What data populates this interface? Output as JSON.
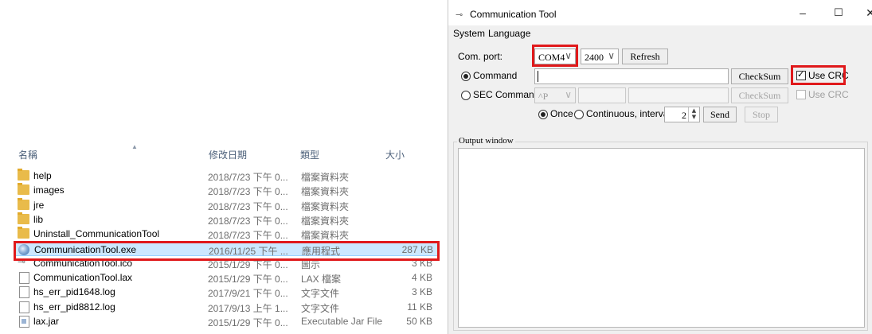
{
  "explorer": {
    "columns": {
      "name": "名稱",
      "date": "修改日期",
      "type": "類型",
      "size": "大小"
    },
    "files": [
      {
        "name": "help",
        "date": "2018/7/23 下午 0...",
        "type": "檔案資料夾",
        "size": "",
        "icon": "folder-icon"
      },
      {
        "name": "images",
        "date": "2018/7/23 下午 0...",
        "type": "檔案資料夾",
        "size": "",
        "icon": "folder-icon"
      },
      {
        "name": "jre",
        "date": "2018/7/23 下午 0...",
        "type": "檔案資料夾",
        "size": "",
        "icon": "folder-icon"
      },
      {
        "name": "lib",
        "date": "2018/7/23 下午 0...",
        "type": "檔案資料夾",
        "size": "",
        "icon": "folder-icon"
      },
      {
        "name": "Uninstall_CommunicationTool",
        "date": "2018/7/23 下午 0...",
        "type": "檔案資料夾",
        "size": "",
        "icon": "folder-icon"
      },
      {
        "name": "CommunicationTool.exe",
        "date": "2016/11/25 下午 ...",
        "type": "應用程式",
        "size": "287 KB",
        "icon": "exe-icon",
        "selected": true
      },
      {
        "name": "CommunicationTool.ico",
        "date": "2015/1/29 下午 0...",
        "type": "圖示",
        "size": "3 KB",
        "icon": "ico-icon"
      },
      {
        "name": "CommunicationTool.lax",
        "date": "2015/1/29 下午 0...",
        "type": "LAX 檔案",
        "size": "4 KB",
        "icon": "file-icon"
      },
      {
        "name": "hs_err_pid1648.log",
        "date": "2017/9/21 下午 0...",
        "type": "文字文件",
        "size": "3 KB",
        "icon": "text-file-icon"
      },
      {
        "name": "hs_err_pid8812.log",
        "date": "2017/9/13 上午 1...",
        "type": "文字文件",
        "size": "11 KB",
        "icon": "text-file-icon"
      },
      {
        "name": "lax.jar",
        "date": "2015/1/29 下午 0...",
        "type": "Executable Jar File",
        "size": "50 KB",
        "icon": "jar-icon"
      }
    ]
  },
  "comm": {
    "title": "Communication Tool",
    "window_controls": {
      "minimize": "–",
      "maximize": "☐",
      "close": "✕"
    },
    "menu": [
      "System",
      "Language"
    ],
    "com_port_label": "Com. port:",
    "com_port_value": "COM4",
    "baud_value": "2400",
    "refresh_label": "Refresh",
    "command_label": "Command",
    "command_value": "",
    "checksum_label": "CheckSum",
    "use_crc_label": "Use CRC",
    "sec_command_label": "SEC Command",
    "sec_prefix_value": "^P",
    "sec_checksum_label": "CheckSum",
    "sec_use_crc_label": "Use CRC",
    "once_label": "Once",
    "continuous_label": "Continuous, interval",
    "interval_value": "2",
    "send_label": "Send",
    "stop_label": "Stop",
    "output_window_label": "Output window",
    "chevron": "∨"
  }
}
